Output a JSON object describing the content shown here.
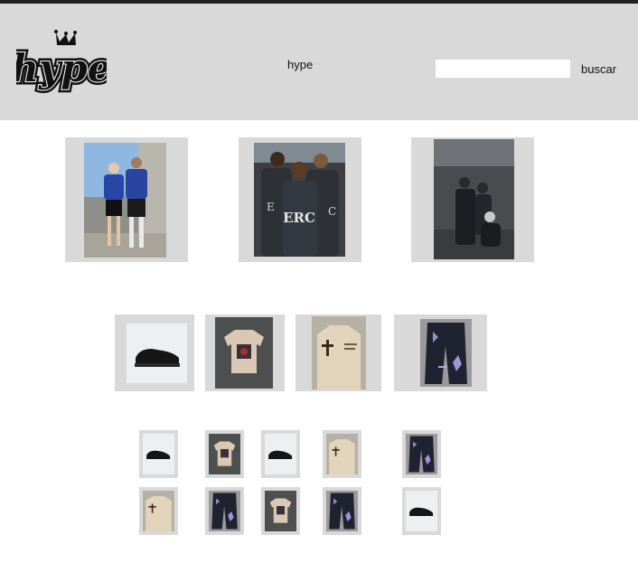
{
  "header": {
    "logo_text": "hype",
    "nav_link": "hype",
    "search": {
      "placeholder": "",
      "value": "",
      "button_label": "buscar"
    }
  },
  "featured": [
    {
      "name": "photo-two-models-blue-hoodies"
    },
    {
      "name": "photo-three-models-gray-hoodies"
    },
    {
      "name": "photo-group-dark-outfits"
    }
  ],
  "products": [
    {
      "name": "black-sneaker"
    },
    {
      "name": "graphic-tshirt"
    },
    {
      "name": "beige-cross-hoodie"
    },
    {
      "name": "dark-graphic-jeans"
    }
  ],
  "thumbnails": [
    "black-sneaker",
    "graphic-tshirt",
    "black-sneaker",
    "beige-cross-hoodie",
    "dark-graphic-jeans",
    "beige-cross-hoodie",
    "dark-graphic-jeans",
    "graphic-tshirt",
    "dark-graphic-jeans",
    "black-sneaker"
  ]
}
